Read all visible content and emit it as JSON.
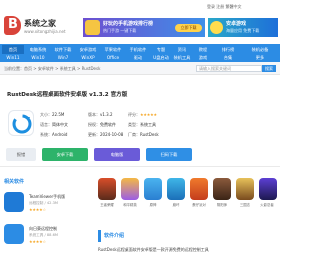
{
  "header": {
    "logo_letter": "B",
    "site_title": "系统之家",
    "site_sub": "www.xitongzhijia.net",
    "toplinks": "登录  注册  繁體中文",
    "banner1": {
      "title": "好玩的手机游戏排行榜",
      "sub": "热门手游 一键下载",
      "button": "立即下载"
    },
    "banner2": {
      "title": "安卓游戏",
      "sub": "海量应用 免费下载"
    }
  },
  "nav": {
    "row1": [
      "首页",
      "电脑系统",
      "软件下载",
      "安卓游戏",
      "苹果软件",
      "手机软件",
      "专题",
      "资讯",
      "教程",
      "排行榜",
      "装机必备"
    ],
    "row2": [
      "Win11",
      "Win10",
      "Win7",
      "WinXP",
      "Office",
      "驱动",
      "U盘启动",
      "装机工具",
      "游戏",
      "合集",
      "更多"
    ]
  },
  "searchstrip": {
    "crumb": "当前位置：首页 > 安卓软件 > 系统工具 > RustDesk",
    "search_placeholder": "请输入搜索关键词",
    "search_button": "搜索"
  },
  "app": {
    "title": "RustDesk远程桌面软件安卓版 v1.3.2 官方版",
    "meta_left": [
      {
        "label": "大小：",
        "value": "22.5M"
      },
      {
        "label": "语言：",
        "value": "简体中文"
      },
      {
        "label": "系统：",
        "value": "Android"
      }
    ],
    "meta_mid": [
      {
        "label": "版本：",
        "value": "v1.3.2"
      },
      {
        "label": "授权：",
        "value": "免费软件"
      },
      {
        "label": "更新：",
        "value": "2024-10-08"
      }
    ],
    "meta_right": [
      {
        "label": "评分：",
        "value": "★★★★★"
      },
      {
        "label": "类型：",
        "value": "系统工具"
      },
      {
        "label": "厂商：",
        "value": "RustDesk"
      }
    ],
    "buttons": {
      "report": "报错",
      "android": "安卓下载",
      "pc": "电脑版",
      "scan": "扫码下载"
    }
  },
  "related": {
    "title": "相关软件",
    "items": [
      {
        "name": "TeamViewer手机版",
        "sub": "远程控制 / 42.3M",
        "stars": "★★★★☆"
      },
      {
        "name": "向日葵远程控制",
        "sub": "系统工具 / 88.6M",
        "stars": "★★★★☆"
      }
    ]
  },
  "grid": {
    "labels": [
      "王者荣耀",
      "和平精英",
      "原神",
      "崩坏",
      "蛋仔派对",
      "阴阳师",
      "三国志",
      "火影忍者"
    ]
  },
  "section": {
    "title": "软件介绍",
    "line": "RustDesk远程桌面软件安卓版是一款开源免费的远程控制工具"
  },
  "colors": {
    "accent": "#2c8ce4",
    "logo": "#d9443a",
    "green": "#2db36a",
    "purple": "#6a5bd8",
    "blue": "#2f8fe5"
  }
}
